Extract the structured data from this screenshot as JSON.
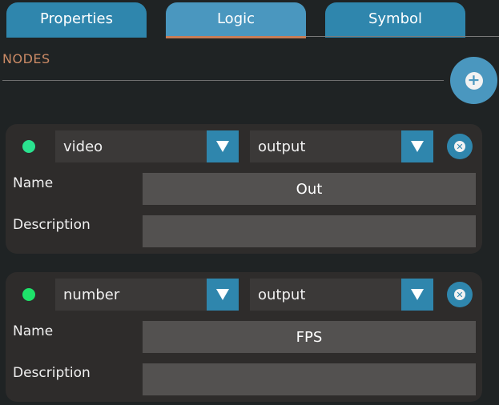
{
  "tabs": [
    {
      "label": "Properties",
      "active": false
    },
    {
      "label": "Logic",
      "active": true
    },
    {
      "label": "Symbol",
      "active": false
    }
  ],
  "section_title": "NODES",
  "add_button": {
    "icon": "plus-icon"
  },
  "nodes": [
    {
      "status_color": "#2ae28f",
      "type": "video",
      "direction": "output",
      "name_label": "Name",
      "name": "Out",
      "description_label": "Description",
      "description": ""
    },
    {
      "status_color": "#1ee36a",
      "type": "number",
      "direction": "output",
      "name_label": "Name",
      "name": "FPS",
      "description_label": "Description",
      "description": ""
    }
  ],
  "colors": {
    "accent": "#2f86ad",
    "active_tab_underline": "#c67d57",
    "section_title": "#cc8b66",
    "background": "#1f2324"
  }
}
